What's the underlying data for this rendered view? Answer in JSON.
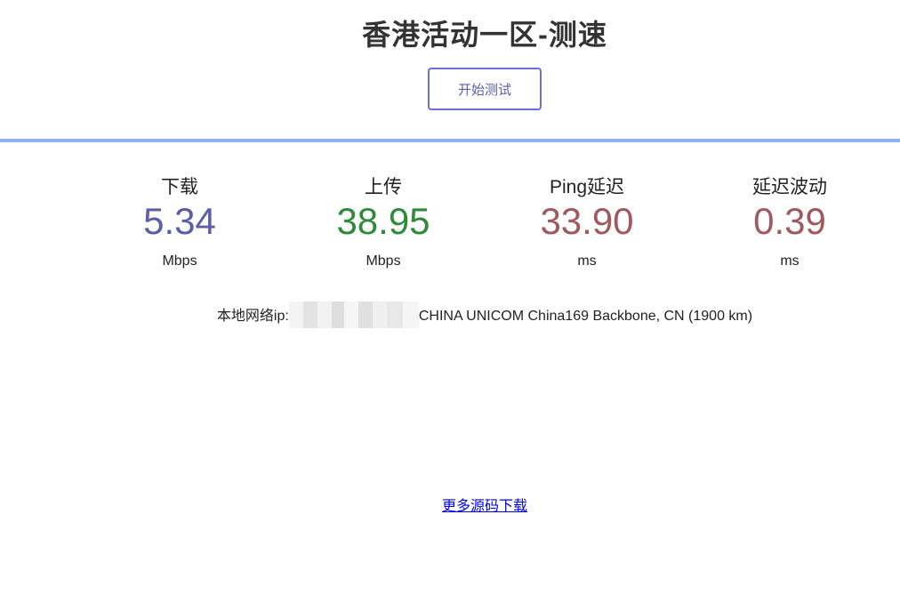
{
  "page": {
    "title": "香港活动一区-测速",
    "start_button_label": "开始测试"
  },
  "colors": {
    "divider": "#8fb4f5",
    "download": "#5c5fa8",
    "upload": "#2e8b3a",
    "ping": "#a05a5f",
    "jitter": "#a05a5f"
  },
  "meters": {
    "download": {
      "label": "下载",
      "value": "5.34",
      "unit": "Mbps"
    },
    "upload": {
      "label": "上传",
      "value": "38.95",
      "unit": "Mbps"
    },
    "ping": {
      "label": "Ping延迟",
      "value": "33.90",
      "unit": "ms"
    },
    "jitter": {
      "label": "延迟波动",
      "value": "0.39",
      "unit": "ms"
    }
  },
  "ip_info": {
    "label": "本地网络ip:",
    "isp": "CHINA UNICOM China169 Backbone, CN (1900 km)"
  },
  "footer": {
    "more_source_link": "更多源码下载"
  }
}
